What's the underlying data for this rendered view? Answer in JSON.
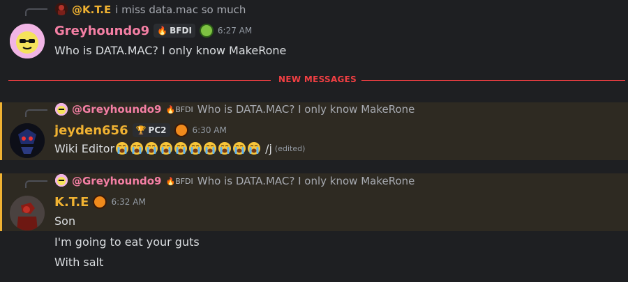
{
  "messages": [
    {
      "reply": {
        "author": "@K.T.E",
        "text": "i miss data.mac so much"
      },
      "author": "Greyhoundo9",
      "author_color": "#f47fa4",
      "badge": "BFDI",
      "timestamp": "6:27 AM",
      "lines": [
        "Who is DATA.MAC? I only know MakeRone"
      ]
    },
    {
      "reply": {
        "author": "@Greyhoundo9",
        "badge": "BFDI",
        "text": "Who is DATA.MAC? I only know MakeRone"
      },
      "author": "jeyden656",
      "author_color": "#f0b232",
      "badge": "PC2",
      "timestamp": "6:30 AM",
      "text_prefix": "Wiki Editor",
      "emoji_name": "loudly-crying-face",
      "emoji_count": 10,
      "text_suffix": "/j",
      "edited": "(edited)"
    },
    {
      "reply": {
        "author": "@Greyhoundo9",
        "badge": "BFDI",
        "text": "Who is DATA.MAC? I only know MakeRone"
      },
      "author": "K.T.E",
      "author_color": "#f0b232",
      "timestamp": "6:32 AM",
      "lines": [
        "Son",
        "I'm going to eat your guts",
        "With salt"
      ]
    }
  ],
  "divider_label": "NEW MESSAGES",
  "colors": {
    "mention_highlight": "#2e2a22",
    "mention_bar": "#f0b232",
    "divider": "#f23f43"
  }
}
